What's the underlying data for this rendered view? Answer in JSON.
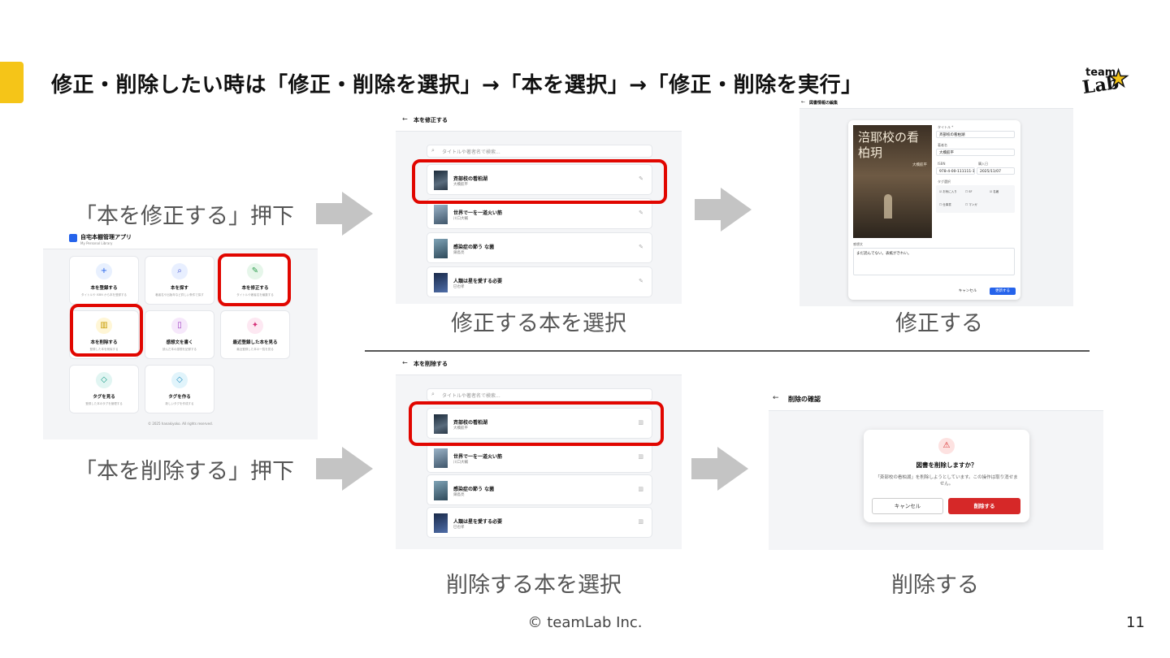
{
  "slide": {
    "heading": "修正・削除したい時は「修正・削除を選択」→「本を選択」→「修正・削除を実行」",
    "logo_text_top": "team",
    "logo_text_bottom": "Lab",
    "footer": "© teamLab Inc.",
    "page_number": "11",
    "accent_color": "#f5c518",
    "highlight_color": "#e10600"
  },
  "captions": {
    "edit_press": "「本を修正する」押下",
    "delete_press": "「本を削除する」押下",
    "select_edit": "修正する本を選択",
    "do_edit": "修正する",
    "select_delete": "削除する本を選択",
    "do_delete": "削除する"
  },
  "home": {
    "app_title": "自宅本棚管理アプリ",
    "app_subtitle": "My Personal Library",
    "cards": [
      {
        "label": "本を登録する",
        "desc": "タイトルや ISBN から本を登録する",
        "icon": "plus-icon",
        "glyph": "+",
        "color": "#e8f0fe",
        "fg": "#2563eb"
      },
      {
        "label": "本を探す",
        "desc": "著者名や出版年など詳しい条件で探す",
        "icon": "search-icon",
        "glyph": "⌕",
        "color": "#e8efff",
        "fg": "#4a5bd4"
      },
      {
        "label": "本を修正する",
        "desc": "タイトルや著者名を編集する",
        "icon": "pencil-icon",
        "glyph": "✎",
        "color": "#e6f6ea",
        "fg": "#2e9e4f"
      },
      {
        "label": "本を削除する",
        "desc": "登録した本を削除する",
        "icon": "trash-icon",
        "glyph": "🗑",
        "color": "#fff6d6",
        "fg": "#c79a00"
      },
      {
        "label": "感想文を書く",
        "desc": "読んだ本の感想を記録する",
        "icon": "document-icon",
        "glyph": "▯",
        "color": "#f6e8fb",
        "fg": "#a03fc2"
      },
      {
        "label": "最近登録した本を見る",
        "desc": "最近登録した本の一覧を見る",
        "icon": "sparkle-icon",
        "glyph": "✦",
        "color": "#fde8f2",
        "fg": "#d6337a"
      },
      {
        "label": "タグを見る",
        "desc": "登録した本のタグを管理する",
        "icon": "tag-icon",
        "glyph": "◇",
        "color": "#e1f5f2",
        "fg": "#159a86"
      },
      {
        "label": "タグを作る",
        "desc": "新しいタグを作成する",
        "icon": "tag-icon",
        "glyph": "◇",
        "color": "#e1f4fb",
        "fg": "#1e8cbe"
      }
    ],
    "copyright": "© 2025 hanakiyoko. All rights reserved."
  },
  "edit_list": {
    "title": "本を修正する",
    "search_placeholder": "タイトルや著者名で検索...",
    "books": [
      {
        "title": "斉部校の看柏湖",
        "author": "大橋航平"
      },
      {
        "title": "世界で一を一道火い筋",
        "author": "川口大輔"
      },
      {
        "title": "感染症の節う な菌",
        "author": "鍋島亮"
      },
      {
        "title": "人類は星を愛する必要",
        "author": "巳也孝"
      }
    ]
  },
  "edit_form": {
    "title": "図書情報の編集",
    "cover_title": "涪耶校の看柏玥",
    "cover_author": "大橋航平",
    "title_label": "タイトル *",
    "title_value": "斉部校の看柏湖",
    "author_label": "著者名",
    "author_value": "大橋航平",
    "isbn_label": "ISBN",
    "isbn_value": "978-4-00-111111-1",
    "date_label": "購入日",
    "date_value": "2025/11/07",
    "tags_label": "タグ選択",
    "tags": [
      "お気に入り",
      "SF",
      "名著",
      "仕事書",
      "マンガ"
    ],
    "note_label": "感想文",
    "note_value": "まだ読んでない。表紙がきれい。",
    "cancel": "キャンセル",
    "save": "更新する"
  },
  "delete_list": {
    "title": "本を削除する",
    "search_placeholder": "タイトルや著者名で検索...",
    "books": [
      {
        "title": "斉部校の看柏湖",
        "author": "大橋航平"
      },
      {
        "title": "世界で一を一道火い筋",
        "author": "川口大輔"
      },
      {
        "title": "感染症の節う な菌",
        "author": "鍋島亮"
      },
      {
        "title": "人類は星を愛する必要",
        "author": "巳也孝"
      }
    ]
  },
  "delete_confirm": {
    "title": "削除の確認",
    "question": "図書を削除しますか？",
    "message": "「斉部校の看柏湖」を削除しようとしています。この操作は取り消せません。",
    "cancel": "キャンセル",
    "confirm": "削除する"
  }
}
